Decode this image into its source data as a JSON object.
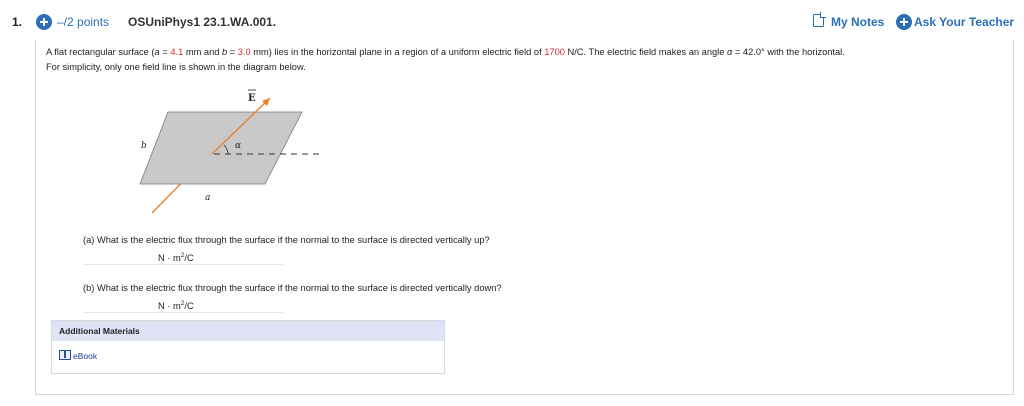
{
  "header": {
    "question_number": "1.",
    "points": "–/2 points",
    "question_id": "OSUniPhys1 23.1.WA.001.",
    "my_notes": "My Notes",
    "ask_teacher": "Ask Your Teacher"
  },
  "problem": {
    "t1": "A flat rectangular surface (",
    "var_a": "a",
    "eq": " = ",
    "a_value": "4.1",
    "t2": " mm and ",
    "var_b": "b",
    "b_value": "3.0",
    "t3": " mm) lies in the horizontal plane in a region of a uniform electric field of ",
    "field_value": "1700",
    "t4": " N/C. The electric field makes an angle ",
    "var_alpha": "α",
    "t5": " = 42.0° with the horizontal.",
    "line2": "For simplicity, only one field line is shown in the diagram below."
  },
  "diagram": {
    "label_E": "E",
    "label_b": "b",
    "label_a": "a",
    "label_alpha": "α",
    "colors": {
      "plane": "#c9c9c9",
      "plane_edge": "#7a7a7a",
      "field_line": "#e8822f"
    }
  },
  "parts": {
    "a_question": "(a) What is the electric flux through the surface if the normal to the surface is directed vertically up?",
    "b_question": "(b) What is the electric flux through the surface if the normal to the surface is directed vertically down?",
    "unit_prefix": "N · m",
    "unit_exp": "2",
    "unit_suffix": "/C"
  },
  "materials": {
    "title": "Additional Materials",
    "ebook": "eBook"
  }
}
